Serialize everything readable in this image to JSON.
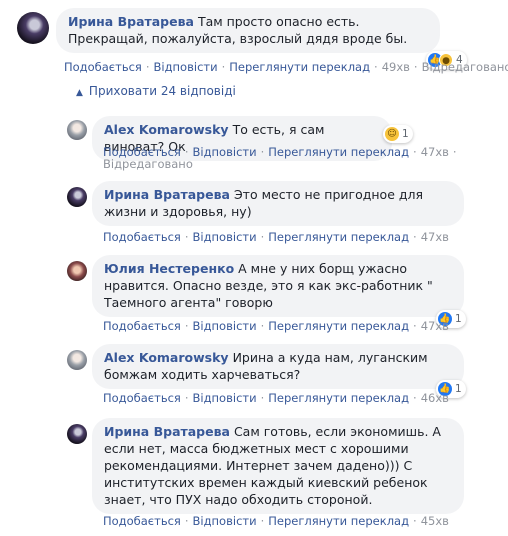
{
  "top_comment": {
    "author": "Ирина Вратарева",
    "text": "Там просто опасно есть. Прекращай, пожалуйста, взрослый дядя вроде бы.",
    "reactions": {
      "icons": [
        "like-icon",
        "wow-icon"
      ],
      "count": "4"
    },
    "actions": {
      "like": "Подобається",
      "reply": "Відповісти",
      "translate": "Переглянути переклад",
      "time": "49хв",
      "edited": "Відредаговано"
    }
  },
  "hide_replies": {
    "label": "Приховати 24 відповіді",
    "icon": "chevron-up-icon"
  },
  "replies": [
    {
      "author": "Alex Komarowsky",
      "text": "То есть, я сам виноват? Ок",
      "reactions": {
        "icons": [
          "haha-icon"
        ],
        "count": "1"
      },
      "actions": {
        "like": "Подобається",
        "reply": "Відповісти",
        "translate": "Переглянути переклад",
        "time": "47хв",
        "edited": "Відредаговано"
      }
    },
    {
      "author": "Ирина Вратарева",
      "text": "Это место не пригодное для жизни и здоровья, ну)",
      "actions": {
        "like": "Подобається",
        "reply": "Відповісти",
        "translate": "Переглянути переклад",
        "time": "47хв"
      }
    },
    {
      "author": "Юлия Нестеренко",
      "text": "А мне у них борщ ужасно нравится. Опасно везде, это я как экс-работник \" Таемного агента\" говорю",
      "reactions": {
        "icons": [
          "like-icon"
        ],
        "count": "1"
      },
      "actions": {
        "like": "Подобається",
        "reply": "Відповісти",
        "translate": "Переглянути переклад",
        "time": "47хв"
      }
    },
    {
      "author": "Alex Komarowsky",
      "text": "Ирина а куда нам, луганским бомжам ходить харчеваться?",
      "reactions": {
        "icons": [
          "like-icon"
        ],
        "count": "1"
      },
      "actions": {
        "like": "Подобається",
        "reply": "Відповісти",
        "translate": "Переглянути переклад",
        "time": "46хв"
      }
    },
    {
      "author": "Ирина Вратарева",
      "text": "Сам готовь, если экономишь. А если нет, масса бюджетных мест с хорошими рекомендациями. Интернет зачем дадено))) С институтских времен каждый киевский ребенок знает, что ПУХ надо обходить стороной.",
      "actions": {
        "like": "Подобається",
        "reply": "Відповісти",
        "translate": "Переглянути переклад",
        "time": "45хв"
      }
    }
  ],
  "colors": {
    "link": "#385898",
    "bubble": "#f2f3f5",
    "meta": "#90949c",
    "like": "#2078f4",
    "emoji": "#f7c33c"
  }
}
